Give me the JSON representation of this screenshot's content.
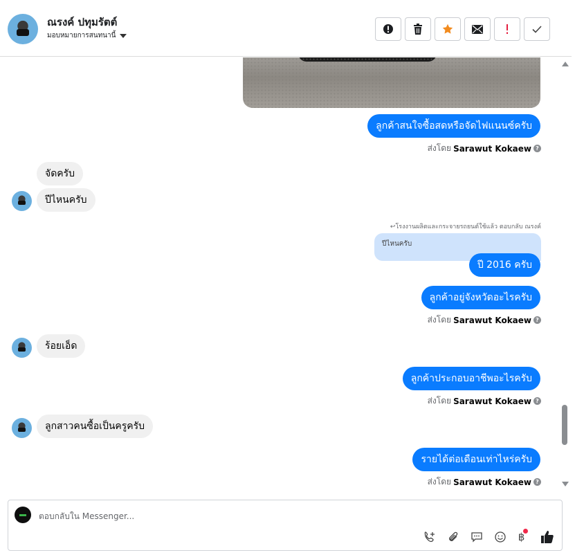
{
  "header": {
    "contact_name": "ณรงค์ ปทุมรัตต์",
    "assign_label": "มอบหมายการสนทนานี้",
    "toolbar_icons": [
      "alert-icon",
      "trash-icon",
      "star-icon",
      "envelope-icon",
      "exclamation-icon",
      "check-icon"
    ],
    "star_color": "#f28b1e",
    "exclamation_color": "#e41e3f"
  },
  "messages": [
    {
      "dir": "out",
      "text": "ลูกค้าสนใจซื้อสดหรือจัดไฟแนนซ์ครับ"
    },
    {
      "dir": "in",
      "text": "จัดครับ"
    },
    {
      "dir": "in",
      "text": "ปีไหนครับ"
    },
    {
      "dir": "out",
      "text": "ปี 2016 ครับ"
    },
    {
      "dir": "out",
      "text": "ลูกค้าอยู่จังหวัดอะไรครับ"
    },
    {
      "dir": "in",
      "text": "ร้อยเอ็ด"
    },
    {
      "dir": "out",
      "text": "ลูกค้าประกอบอาชีพอะไรครับ"
    },
    {
      "dir": "in",
      "text": "ลูกสาวคนซื้อเป็นครูครับ"
    },
    {
      "dir": "out",
      "text": "รายได้ต่อเดือนเท่าไหร่ครับ"
    }
  ],
  "sent_by": {
    "prefix": "ส่งโดย",
    "name": "Sarawut Kokaew"
  },
  "reply": {
    "note": "โรงงานผลิตและกระจายรถยนต์ใช้แล้ว ตอบกลับ ณรงค์",
    "quoted_text": "ปีไหนครับ"
  },
  "composer": {
    "placeholder": "ตอบกลับใน Messenger...",
    "icons": [
      "phone-add-icon",
      "paperclip-icon",
      "chat-bubble-icon",
      "smiley-icon",
      "baht-icon",
      "thumbs-up-icon"
    ],
    "baht_symbol": "฿"
  },
  "colors": {
    "outgoing": "#0a7cff",
    "incoming": "#f0f0f0",
    "quoted": "#cfe3fc"
  }
}
